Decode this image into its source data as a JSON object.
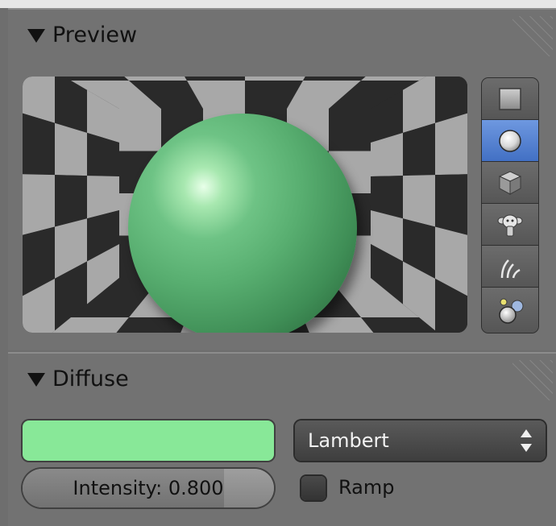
{
  "preview_panel": {
    "title": "Preview",
    "preview_types": [
      {
        "name": "flat-plane-icon",
        "active": false
      },
      {
        "name": "sphere-icon",
        "active": true
      },
      {
        "name": "cube-icon",
        "active": false
      },
      {
        "name": "monkey-icon",
        "active": false
      },
      {
        "name": "hair-strands-icon",
        "active": false
      },
      {
        "name": "sky-sphere-icon",
        "active": false
      }
    ],
    "render_colors": {
      "sphere": "#6ec385",
      "checker_light": "#a8a8a8",
      "checker_dark": "#2a2a2a"
    }
  },
  "diffuse_panel": {
    "title": "Diffuse",
    "color": "#88e898",
    "shader": {
      "value": "Lambert"
    },
    "intensity": {
      "label": "Intensity: 0.800",
      "value": 0.8
    },
    "ramp": {
      "label": "Ramp",
      "checked": false
    }
  },
  "colors": {
    "active_button": "#5584d4",
    "panel_bg": "#727272"
  }
}
